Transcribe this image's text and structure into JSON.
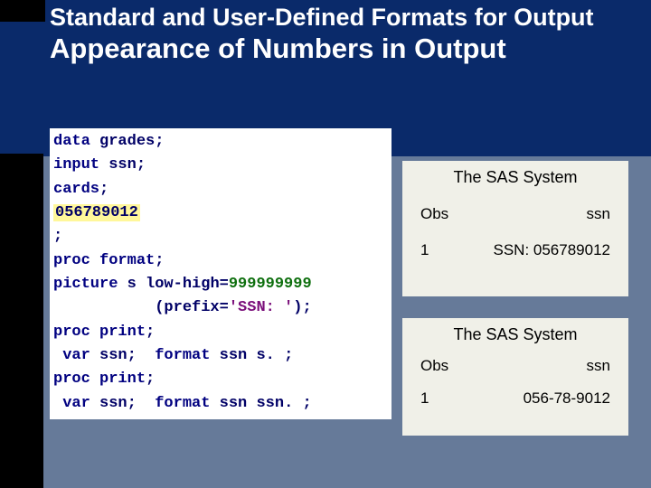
{
  "heading": {
    "line1": "Standard and User-Defined Formats for Output",
    "line2": "Appearance of Numbers in Output"
  },
  "code": {
    "l1a": "data",
    "l1b": " grades;",
    "l2a": "input",
    "l2b": " ssn;",
    "l3a": "cards",
    "l3b": ";",
    "l4": "056789012",
    "l5": ";",
    "l6a": "proc",
    "l6b": " ",
    "l6c": "format",
    "l6d": ";",
    "l7a": "picture",
    "l7b": " s low-high=",
    "l7c": "999999999",
    "l8a": "           (prefix=",
    "l8b": "'SSN: '",
    "l8c": ");",
    "l9a": "proc",
    "l9b": " ",
    "l9c": "print",
    "l9d": ";",
    "l10a": " var",
    "l10b": " ssn;  ",
    "l10c": "format",
    "l10d": " ssn s. ;",
    "l11a": "proc",
    "l11b": " ",
    "l11c": "print",
    "l11d": ";",
    "l12a": " var",
    "l12b": " ssn;  ",
    "l12c": "format",
    "l12d": " ssn ssn. ;"
  },
  "out1": {
    "title": "The SAS System",
    "h1": "Obs",
    "h2": "ssn",
    "d1": "1",
    "d2": "SSN: 056789012"
  },
  "out2": {
    "title": "The SAS System",
    "h1": "Obs",
    "h2": "ssn",
    "d1": "1",
    "d2": "056-78-9012"
  }
}
